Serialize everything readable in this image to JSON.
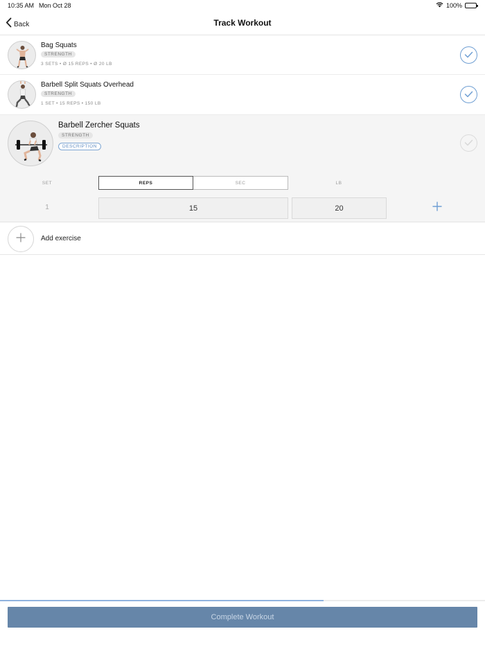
{
  "status_bar": {
    "time": "10:35 AM",
    "date": "Mon Oct 28",
    "battery": "100%",
    "icons": [
      "wifi-icon",
      "battery-icon"
    ]
  },
  "nav": {
    "back_label": "Back",
    "title": "Track Workout"
  },
  "exercises": [
    {
      "name": "Bag Squats",
      "tag": "STRENGTH",
      "meta": "3 SETS • Ø 15 REPS • Ø 20 LB",
      "completed": true
    },
    {
      "name": "Barbell Split Squats Overhead",
      "tag": "STRENGTH",
      "meta": "1 SET • 15 REPS • 150 LB",
      "completed": true
    },
    {
      "name": "Barbell Zercher Squats",
      "tag": "STRENGTH",
      "description_label": "DESCRIPTION",
      "completed": false,
      "expanded": true
    }
  ],
  "sets_table": {
    "col_set": "SET",
    "toggle_reps": "REPS",
    "toggle_sec": "SEC",
    "col_lb": "LB",
    "active_toggle": "REPS",
    "rows": [
      {
        "set": "1",
        "reps": "15",
        "lb": "20"
      }
    ]
  },
  "add_exercise_label": "Add exercise",
  "workout_progress": 0.667,
  "complete_button_label": "Complete Workout",
  "colors": {
    "accent": "#6f9fd3",
    "complete_button": "#6686a9",
    "progress": "#8fb2de"
  }
}
